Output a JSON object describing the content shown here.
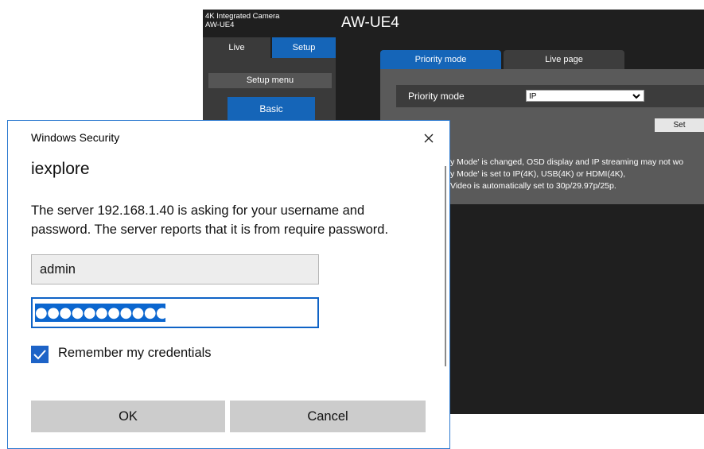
{
  "camera": {
    "model_line1": "4K Integrated Camera",
    "model_line2": "AW-UE4",
    "title": "AW-UE4",
    "nav_tabs": [
      "Live",
      "Setup"
    ],
    "setup_menu_label": "Setup menu",
    "menu_basic": "Basic",
    "tabs": [
      "Priority mode",
      "Live page"
    ],
    "priority_mode_label": "Priority mode",
    "priority_mode_value": "IP",
    "set_button": "Set",
    "notes": [
      "y Mode' is changed, OSD display and IP streaming may not wo",
      "y Mode' is set to IP(4K), USB(4K) or HDMI(4K),",
      " Video is automatically set to 30p/29.97p/25p."
    ],
    "colors": {
      "background": "#1f1f1f",
      "accent": "#1565b8"
    }
  },
  "dialog": {
    "header": "Windows Security",
    "app_name": "iexplore",
    "message_line1": "The server 192.168.1.40 is asking for your username and",
    "message_line2": "password. The server reports that it is from require password.",
    "username_value": "admin",
    "password_value": "●●●●●●●●●●●●●●",
    "remember_label": "Remember my credentials",
    "remember_checked": true,
    "ok_label": "OK",
    "cancel_label": "Cancel",
    "close_icon": "close-icon",
    "colors": {
      "accent": "#0f63c6",
      "button": "#cccccc"
    }
  }
}
